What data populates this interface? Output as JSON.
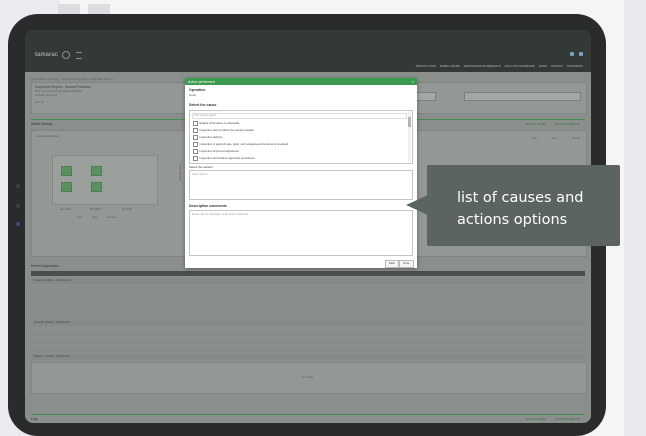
{
  "app": {
    "logo": "tamarac",
    "nav_items": [
      "PRODUCT STOR",
      "MODELS FRAME",
      "MAINTENANCE DE REQUESTS",
      "ANALYTICS DASHBOARD",
      "ADMIN",
      "SUPPORT",
      "DOCUMENTS"
    ]
  },
  "page": {
    "breadcrumb": "Inspection › Planning › Inspection Reports › Inspection Report",
    "report_title": "Inspection Report - Manual Pulldown",
    "report_meta_1": "Date: Jan 1 2023 09:21 / Manual Pulldown",
    "report_meta_2": "Purpose: Inspection",
    "filter_label": "Filter by",
    "section_1_title": "Initial Dating",
    "section_1_links": [
      "VIEW ALL ISSUES",
      "EXPORT AS REPORT"
    ],
    "chart_title": "Inspection Summary",
    "chart_axis": "Average Hours",
    "chart_categories": [
      "Dec 2023",
      "Mar 2024",
      "Jun 2024"
    ],
    "legend": [
      "Fast",
      "Slow",
      "Normal"
    ],
    "table_title": "Event Inspection",
    "table_headers": [
      "Operation name",
      "Hint",
      "Pos",
      "Start",
      "End",
      "Ins",
      "Start date",
      "Rev",
      "Hours",
      "Rate",
      "P1",
      "P2",
      "CE"
    ],
    "group_rows": [
      "Group A - Actions - 12 Shipments",
      "Group B - Actions - 9 Shipments",
      "Group C - Actions - 4 Shipments"
    ],
    "empty_state": "No results",
    "footer_title": "Log",
    "footer_links": [
      "VIEW ALL ISSUES",
      "EXPORT AS REPORT"
    ]
  },
  "modal": {
    "title": "Action performed",
    "close_glyph": "×",
    "field_1_label": "Operation",
    "field_1_value": "Grain",
    "cause_label": "Select the cause",
    "cause_search_placeholder": "Click here to search",
    "causes": [
      "Enable information on placeable",
      "Inspection did not follow the sample location",
      "Inspection delivery",
      "Inspection in approximate, grain, and unregistered documents prepared",
      "Inspection improved adjustment",
      "Inspection technician's approved procedures"
    ],
    "actions_label": "Select the actions",
    "actions_placeholder": "Select actions",
    "description_label": "Description comments",
    "description_placeholder": "Please add the description of the action performed",
    "cancel_label": "Back",
    "save_label": "Done"
  },
  "callout": {
    "text": "list of causes and actions options"
  },
  "colors": {
    "modal_header": "#3b9a4e",
    "callout_bg": "#5b645e",
    "tablet": "#2a2b2d",
    "appbar": "#333a36"
  }
}
